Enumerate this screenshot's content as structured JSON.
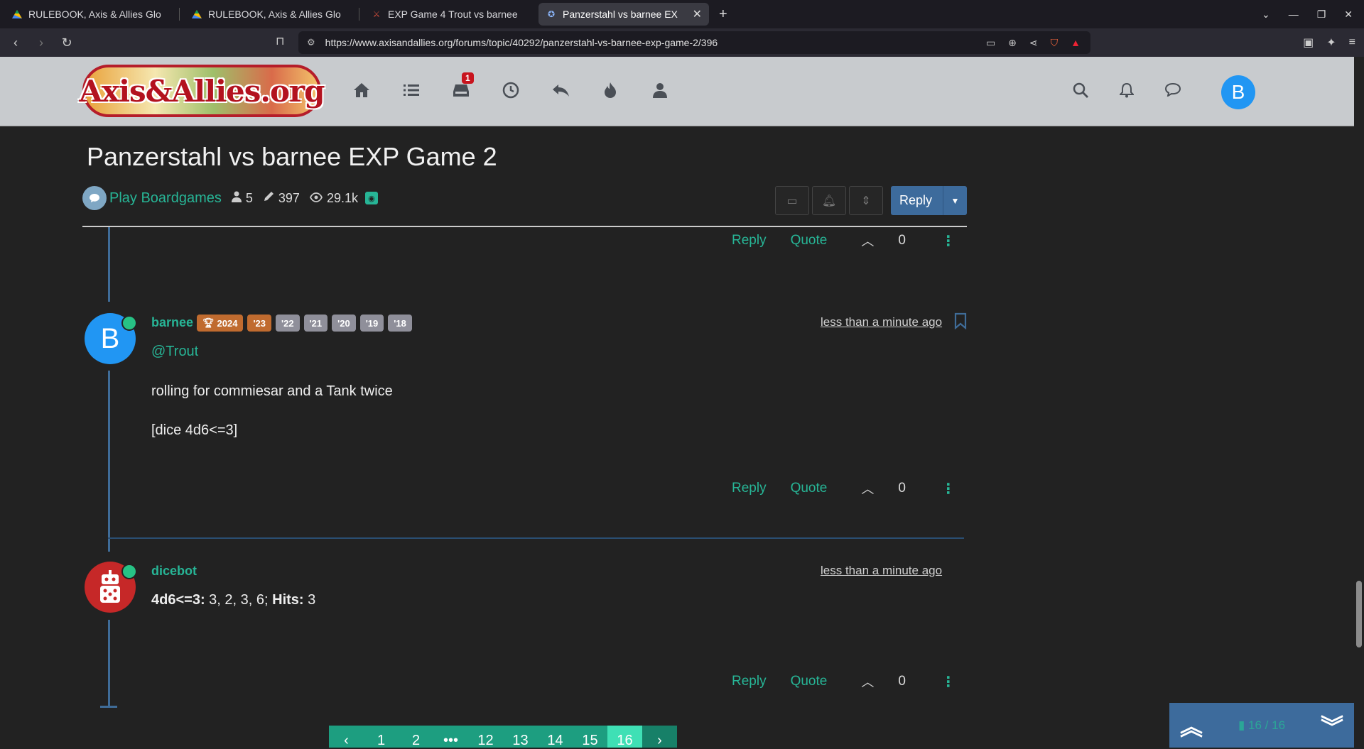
{
  "browser": {
    "tabs": [
      {
        "title": "RULEBOOK, Axis & Allies Glo",
        "icon": "drive-icon"
      },
      {
        "title": "RULEBOOK, Axis & Allies Glo",
        "icon": "drive-icon"
      },
      {
        "title": "EXP Game 4 Trout vs barnee",
        "icon": "forum-icon"
      },
      {
        "title": "Panzerstahl vs barnee EX",
        "icon": "forum-icon",
        "active": true
      }
    ],
    "url": "https://www.axisandallies.org/forums/topic/40292/panzerstahl-vs-barnee-exp-game-2/396"
  },
  "header": {
    "logo_text": "Axis&Allies.org",
    "notification_count": "1",
    "user_initial": "B"
  },
  "topic": {
    "title": "Panzerstahl vs barnee EXP Game 2",
    "category": "Play Boardgames",
    "posters": "5",
    "posts": "397",
    "views": "29.1k",
    "reply_label": "Reply"
  },
  "actions": {
    "reply": "Reply",
    "quote": "Quote"
  },
  "posts": [
    {
      "votes": "0"
    },
    {
      "author": "barnee",
      "initial": "B",
      "flairs": [
        {
          "label": "2024",
          "gold": true
        },
        {
          "label": "'23",
          "gold": true
        },
        {
          "label": "'22"
        },
        {
          "label": "'21"
        },
        {
          "label": "'20"
        },
        {
          "label": "'19"
        },
        {
          "label": "'18"
        }
      ],
      "time": "less than a minute ago",
      "mention": "@Trout",
      "line1": "rolling for commiesar and a Tank twice",
      "line2": "[dice 4d6<=3]",
      "votes": "0"
    },
    {
      "author": "dicebot",
      "time": "less than a minute ago",
      "roll_label": "4d6<=3:",
      "roll_values": " 3, 2, 3, 6; ",
      "hits_label": "Hits:",
      "hits_value": " 3",
      "votes": "0"
    }
  ],
  "pagination": {
    "pages": [
      "1",
      "2",
      "•••",
      "12",
      "13",
      "14",
      "15",
      "16"
    ],
    "active": "16"
  },
  "post_counter": "16 / 16",
  "colors": {
    "accent": "#27b596",
    "primary": "#3d6b9c",
    "background": "#222222"
  }
}
